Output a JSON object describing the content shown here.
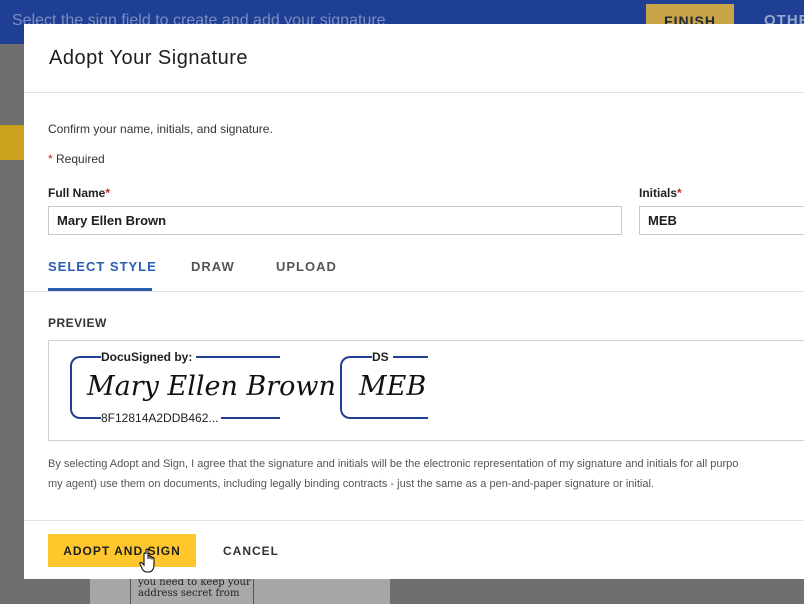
{
  "background": {
    "topbar_message": "Select the sign field to create and add your signature",
    "finish_label": "FINISH",
    "other_label": "OTHE",
    "note_line1": "you need to keep your",
    "note_line2": "address secret from"
  },
  "modal": {
    "title": "Adopt Your Signature",
    "confirm_text": "Confirm your name, initials, and signature.",
    "required_star": "*",
    "required_text": "Required",
    "full_name": {
      "label": "Full Name",
      "star": "*",
      "value": "Mary Ellen Brown"
    },
    "initials": {
      "label": "Initials",
      "star": "*",
      "value": "MEB"
    },
    "tabs": [
      {
        "label": "SELECT STYLE",
        "active": true
      },
      {
        "label": "DRAW",
        "active": false
      },
      {
        "label": "UPLOAD",
        "active": false
      }
    ],
    "preview_label": "PREVIEW",
    "signature": {
      "caption": "DocuSigned by:",
      "handwriting": "Mary Ellen Brown",
      "id": "8F12814A2DDB462..."
    },
    "initials_preview": {
      "caption": "DS",
      "handwriting": "MEB"
    },
    "disclaimer_line1": "By selecting Adopt and Sign, I agree that the signature and initials will be the electronic representation of my signature and initials for all purpo",
    "disclaimer_line2": "my agent) use them on documents, including legally binding contracts - just the same as a pen-and-paper signature or initial.",
    "adopt_button": "ADOPT AND SIGN",
    "cancel_button": "CANCEL"
  },
  "colors": {
    "accent_blue": "#2a5db0",
    "signature_frame": "#1f3f94",
    "button_yellow": "#ffc72c",
    "required_red": "#c2262e"
  },
  "icons": [
    "hand-pointer-cursor-icon"
  ]
}
